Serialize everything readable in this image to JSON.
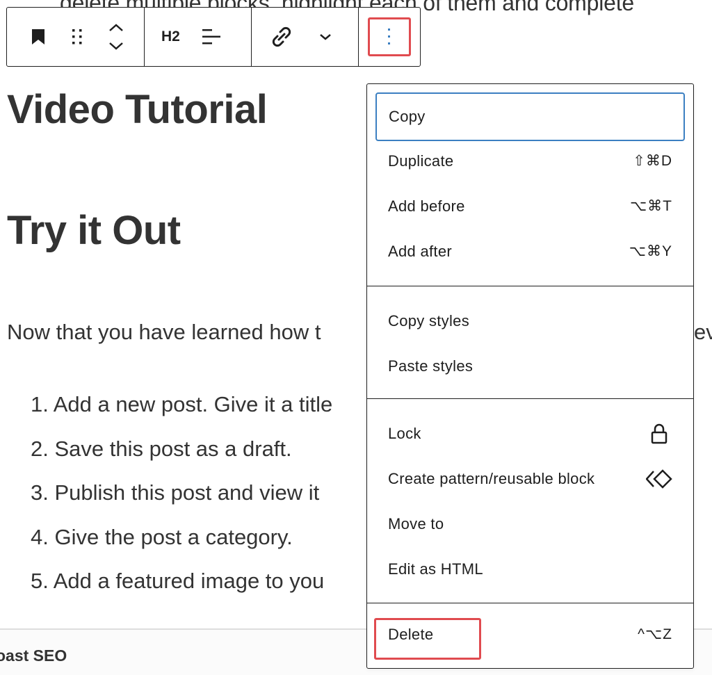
{
  "document": {
    "top_text_fragment": "delete multiple blocks, highlight each of them and complete",
    "heading_1": "Video Tutorial",
    "heading_2": "Try it Out",
    "paragraph_fragment": "Now that you have learned how t",
    "paragraph_right_fragment": "ev",
    "list_items": [
      "1. Add a new post. Give it a title",
      "2. Save this post as a draft.",
      "3. Publish this post and view it",
      "4. Give the post a category.",
      "5. Add a featured image to you"
    ]
  },
  "footer": {
    "panel_label": "oast SEO"
  },
  "block_toolbar": {
    "block_type_icon": "bookmark-icon",
    "drag_icon": "drag-handle-icon",
    "move_up_icon": "chevron-up-icon",
    "move_down_icon": "chevron-down-icon",
    "heading_level_label": "H2",
    "align_icon": "align-icon",
    "link_icon": "link-icon",
    "more_rich_text_icon": "chevron-down-icon",
    "options_icon": "more-vertical-icon",
    "highlight_color": "#e04b4f",
    "options_dots_color": "#3b7fc1"
  },
  "options_menu": {
    "groups": [
      {
        "items": [
          {
            "label": "Copy",
            "shortcut": "",
            "focused": true
          },
          {
            "label": "Duplicate",
            "shortcut": "⇧⌘D"
          },
          {
            "label": "Add before",
            "shortcut": "⌥⌘T"
          },
          {
            "label": "Add after",
            "shortcut": "⌥⌘Y"
          }
        ]
      },
      {
        "items": [
          {
            "label": "Copy styles"
          },
          {
            "label": "Paste styles"
          }
        ]
      },
      {
        "items": [
          {
            "label": "Lock",
            "icon": "lock-icon"
          },
          {
            "label": "Create pattern/reusable block",
            "icon": "symbol-icon"
          },
          {
            "label": "Move to"
          },
          {
            "label": "Edit as HTML"
          }
        ]
      },
      {
        "items": [
          {
            "label": "Delete",
            "shortcut": "^⌥Z",
            "highlighted": true
          }
        ]
      }
    ],
    "focus_color": "#3b7fc1"
  }
}
